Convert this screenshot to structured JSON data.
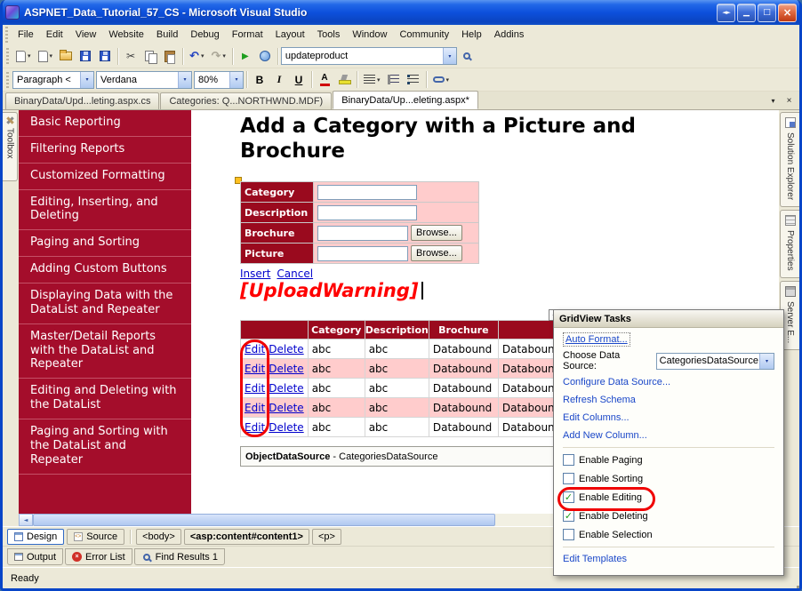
{
  "window": {
    "title": "ASPNET_Data_Tutorial_57_CS - Microsoft Visual Studio"
  },
  "icons": {
    "swap": "◄►",
    "minimize": "▁",
    "maximize": "□",
    "close": "×",
    "dropdown": "▾",
    "overflow": "▾",
    "tab_close": "×",
    "scroll_left": "◄",
    "scroll_right": "►",
    "smart_tag": "◄",
    "check": "✓",
    "cut": "✂",
    "undo": "↶",
    "redo": "↷",
    "play": "▶"
  },
  "menu": {
    "items": [
      "File",
      "Edit",
      "View",
      "Website",
      "Build",
      "Debug",
      "Format",
      "Layout",
      "Tools",
      "Window",
      "Community",
      "Help",
      "Addins"
    ]
  },
  "toolbar": {
    "combo_value": "updateproduct"
  },
  "format_toolbar": {
    "block_format": "Paragraph <",
    "font_name": "Verdana",
    "font_size": "80%",
    "bold": "B",
    "italic": "I",
    "underline": "U",
    "font_color": "A"
  },
  "document_tabs": {
    "tab1": "BinaryData/Upd...leting.aspx.cs",
    "tab2": "Categories: Q...NORTHWND.MDF)",
    "tab3": "BinaryData/Up...eleting.aspx*"
  },
  "toolbox": {
    "label": "Toolbox"
  },
  "nav": {
    "items": [
      "Basic Reporting",
      "Filtering Reports",
      "Customized Formatting",
      "Editing, Inserting, and Deleting",
      "Paging and Sorting",
      "Adding Custom Buttons",
      "Displaying Data with the DataList and Repeater",
      "Master/Detail Reports with the DataList and Repeater",
      "Editing and Deleting with the DataList",
      "Paging and Sorting with the DataList and Repeater"
    ]
  },
  "page": {
    "heading": "Add a Category with a Picture and Brochure",
    "form": {
      "rows": [
        {
          "label": "Category"
        },
        {
          "label": "Description"
        },
        {
          "label": "Brochure"
        },
        {
          "label": "Picture"
        }
      ],
      "browse_label": "Browse...",
      "insert_link": "Insert",
      "cancel_link": "Cancel"
    },
    "warning": "[UploadWarning]",
    "grid": {
      "headers": [
        "",
        "Category",
        "Description",
        "Brochure",
        ""
      ],
      "rows": [
        {
          "links": [
            "Edit",
            "Delete"
          ],
          "cells": [
            "abc",
            "abc",
            "Databound",
            "Databound"
          ]
        },
        {
          "links": [
            "Edit",
            "Delete"
          ],
          "cells": [
            "abc",
            "abc",
            "Databound",
            "Databound"
          ]
        },
        {
          "links": [
            "Edit",
            "Delete"
          ],
          "cells": [
            "abc",
            "abc",
            "Databound",
            "Databound"
          ]
        },
        {
          "links": [
            "Edit",
            "Delete"
          ],
          "cells": [
            "abc",
            "abc",
            "Databound",
            "Databound"
          ]
        },
        {
          "links": [
            "Edit",
            "Delete"
          ],
          "cells": [
            "abc",
            "abc",
            "Databound",
            "Databound"
          ]
        }
      ]
    },
    "datasource": {
      "name": "ObjectDataSource",
      "suffix": " - CategoriesDataSource"
    }
  },
  "tasks": {
    "title": "GridView Tasks",
    "auto_format": "Auto Format...",
    "choose_label": "Choose Data Source:",
    "datasource_value": "CategoriesDataSource",
    "links": [
      "Configure Data Source...",
      "Refresh Schema",
      "Edit Columns...",
      "Add New Column..."
    ],
    "checkboxes": [
      {
        "label": "Enable Paging",
        "checked": false
      },
      {
        "label": "Enable Sorting",
        "checked": false
      },
      {
        "label": "Enable Editing",
        "checked": true
      },
      {
        "label": "Enable Deleting",
        "checked": true
      },
      {
        "label": "Enable Selection",
        "checked": false
      }
    ],
    "edit_templates": "Edit Templates"
  },
  "right_tabs": {
    "t1": "Solution Explorer",
    "t2": "Properties",
    "t3": "Server E..."
  },
  "bottom": {
    "design_label": "Design",
    "source_label": "Source",
    "breadcrumbs": [
      "<body>",
      "<asp:content#content1>",
      "<p>"
    ],
    "panel_tabs": [
      "Output",
      "Error List",
      "Find Results 1"
    ],
    "status": "Ready"
  }
}
